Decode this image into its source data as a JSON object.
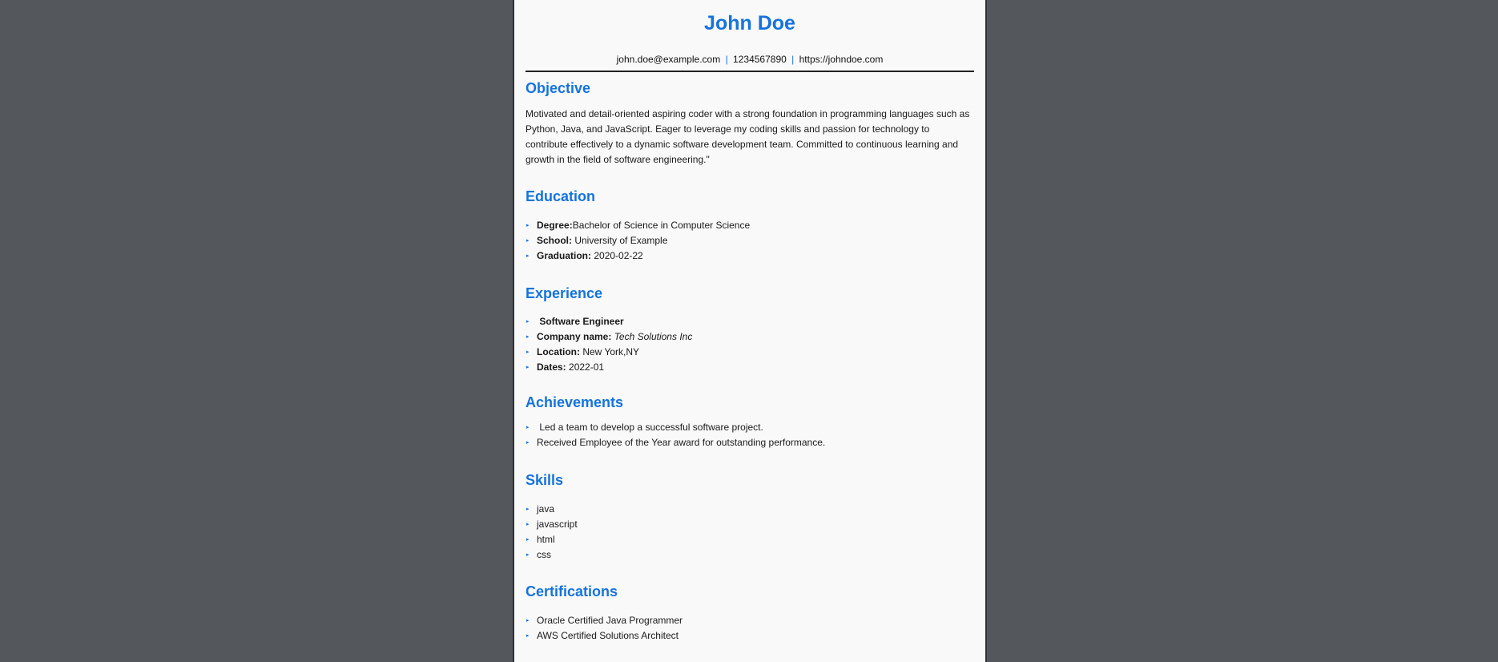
{
  "resume": {
    "name": "John Doe",
    "contact": {
      "email": "john.doe@example.com",
      "separator": "|",
      "phone": "1234567890",
      "website": "https://johndoe.com"
    },
    "objective": {
      "title": "Objective",
      "text": "Motivated and detail-oriented aspiring coder with a strong foundation in programming languages such as Python, Java, and JavaScript. Eager to leverage my coding skills and passion for technology to contribute effectively to a dynamic software development team. Committed to continuous learning and growth in the field of software engineering.\""
    },
    "education": {
      "title": "Education",
      "degree_label": "Degree:",
      "degree_value": "Bachelor of Science in Computer Science",
      "school_label": "School:",
      "school_value": "University of Example",
      "graduation_label": "Graduation:",
      "graduation_value": "2020-02-22"
    },
    "experience": {
      "title": "Experience",
      "job_title": "Software Engineer",
      "company_label": "Company name:",
      "company_value": "Tech Solutions Inc",
      "location_label": "Location:",
      "location_value": "New York,NY",
      "dates_label": "Dates:",
      "dates_value": "2022-01"
    },
    "achievements": {
      "title": "Achievements",
      "items": [
        "Led a team to develop a successful software project.",
        "Received Employee of the Year award for outstanding performance."
      ]
    },
    "skills": {
      "title": "Skills",
      "items": [
        "java",
        "javascript",
        "html",
        "css"
      ]
    },
    "certifications": {
      "title": "Certifications",
      "items": [
        "Oracle Certified Java Programmer",
        "AWS Certified Solutions Architect"
      ]
    }
  },
  "colors": {
    "accent": "#1573dd",
    "background": "#54585c",
    "paper": "#f9f9f9"
  },
  "icons": {
    "bullet": "▸"
  }
}
